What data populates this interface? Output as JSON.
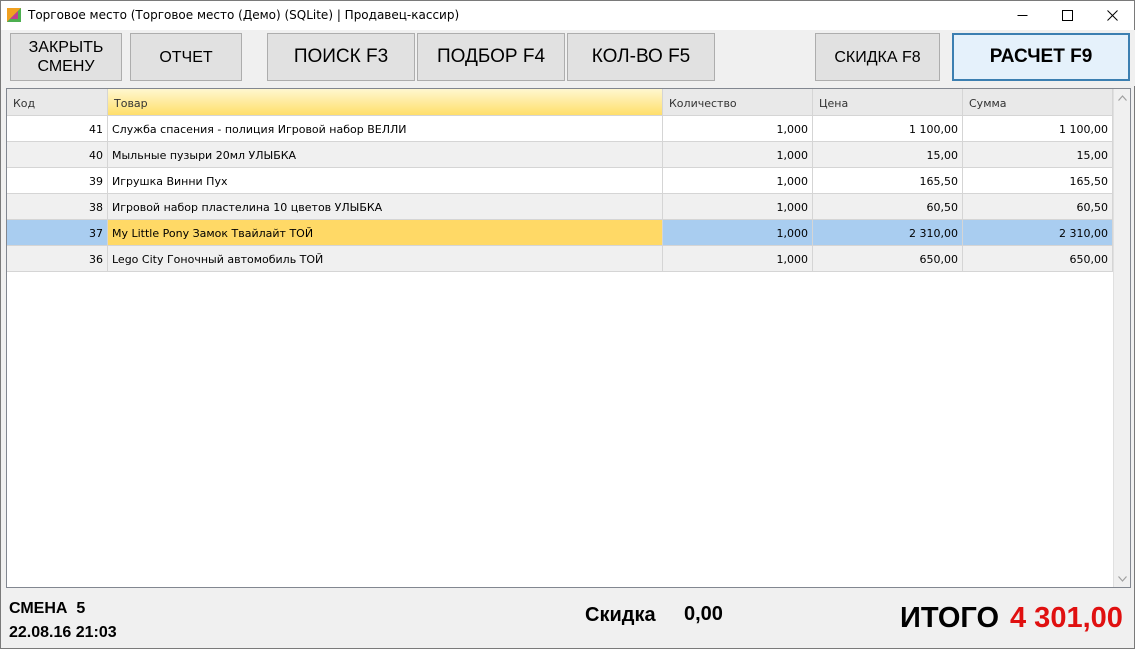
{
  "window": {
    "title": "Торговое место (Торговое место (Демо) (SQLite) | Продавец-кассир)"
  },
  "toolbar": {
    "close_shift": [
      "ЗАКРЫТЬ",
      "СМЕНУ"
    ],
    "report": "ОТЧЕТ",
    "search": "ПОИСК F3",
    "select": "ПОДБОР F4",
    "quantity": "КОЛ-ВО F5",
    "discount": "СКИДКА F8",
    "checkout": "РАСЧЕТ F9"
  },
  "grid": {
    "columns": [
      "Код",
      "Товар",
      "Количество",
      "Цена",
      "Сумма"
    ],
    "rows": [
      {
        "code": "41",
        "name": "Служба спасения - полиция Игровой набор ВЕЛЛИ",
        "qty": "1,000",
        "price": "1 100,00",
        "sum": "1 100,00"
      },
      {
        "code": "40",
        "name": "Мыльные пузыри 20мл УЛЫБКА",
        "qty": "1,000",
        "price": "15,00",
        "sum": "15,00"
      },
      {
        "code": "39",
        "name": "Игрушка Винни Пух",
        "qty": "1,000",
        "price": "165,50",
        "sum": "165,50"
      },
      {
        "code": "38",
        "name": "Игровой набор пластелина 10 цветов УЛЫБКА",
        "qty": "1,000",
        "price": "60,50",
        "sum": "60,50"
      },
      {
        "code": "37",
        "name": "My Little Pony Замок Твайлайт ТОЙ",
        "qty": "1,000",
        "price": "2 310,00",
        "sum": "2 310,00"
      },
      {
        "code": "36",
        "name": "Lego City Гоночный автомобиль ТОЙ",
        "qty": "1,000",
        "price": "650,00",
        "sum": "650,00"
      }
    ],
    "selected_row": 4
  },
  "footer": {
    "shift": "СМЕНА  5",
    "datetime": "22.08.16 21:03",
    "discount_label": "Скидка",
    "discount_value": "0,00",
    "total_label": "ИТОГО",
    "total_value": "4 301,00"
  },
  "colors": {
    "total_value": "#e01010",
    "selected_row": "#a9cdf0",
    "selected_cell": "#ffd966",
    "accent_border": "#3c7fb1"
  }
}
